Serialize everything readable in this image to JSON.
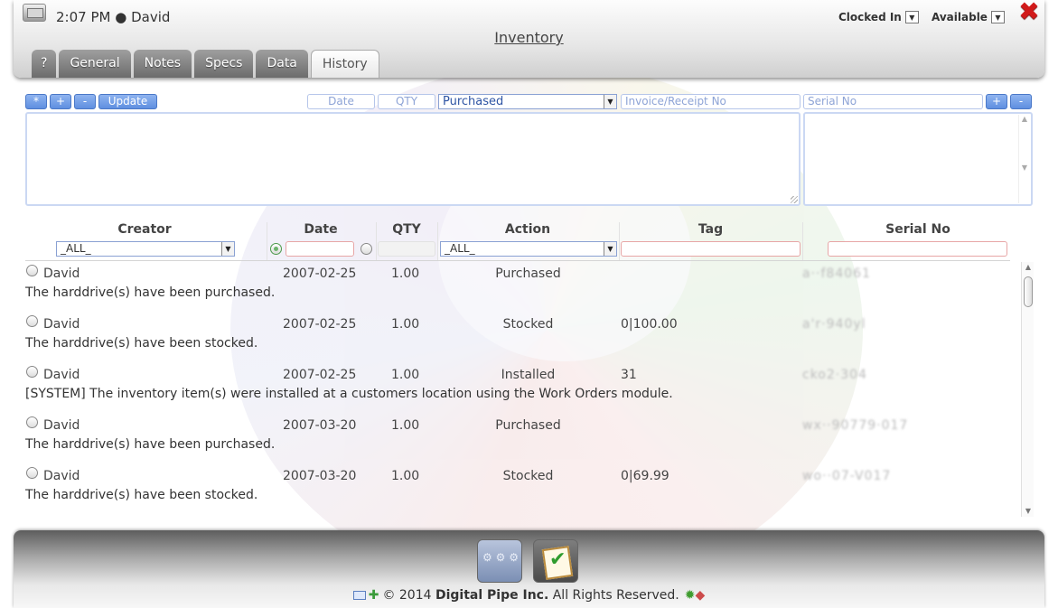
{
  "header": {
    "time": "2:07 PM",
    "user": "David",
    "clock_status": "Clocked In",
    "availability": "Available",
    "title": "Inventory",
    "tabs": [
      {
        "label": "?"
      },
      {
        "label": "General"
      },
      {
        "label": "Notes"
      },
      {
        "label": "Specs"
      },
      {
        "label": "Data"
      },
      {
        "label": "History"
      }
    ],
    "active_tab": "History"
  },
  "entry": {
    "buttons": {
      "star": "*",
      "add": "+",
      "remove": "-",
      "update": "Update"
    },
    "date_placeholder": "Date",
    "qty_placeholder": "QTY",
    "action_value": "Purchased",
    "invoice_placeholder": "Invoice/Receipt No",
    "serial_placeholder": "Serial No",
    "serial_add": "+",
    "serial_remove": "-"
  },
  "table": {
    "columns": {
      "creator": "Creator",
      "date": "Date",
      "qty": "QTY",
      "action": "Action",
      "tag": "Tag",
      "serial": "Serial No"
    },
    "filters": {
      "creator": "_ALL_",
      "action": "_ALL_"
    },
    "rows": [
      {
        "creator": "David",
        "date": "2007-02-25",
        "qty": "1.00",
        "action": "Purchased",
        "tag": "",
        "serial": "a··f84061",
        "note": "The harddrive(s) have been purchased."
      },
      {
        "creator": "David",
        "date": "2007-02-25",
        "qty": "1.00",
        "action": "Stocked",
        "tag": "0|100.00",
        "serial": "a'r·940yl",
        "note": "The harddrive(s) have been stocked."
      },
      {
        "creator": "David",
        "date": "2007-02-25",
        "qty": "1.00",
        "action": "Installed",
        "tag": "31",
        "serial": "cko2·304",
        "note": "[SYSTEM] The inventory item(s) were installed at a customers location using the Work Orders module."
      },
      {
        "creator": "David",
        "date": "2007-03-20",
        "qty": "1.00",
        "action": "Purchased",
        "tag": "",
        "serial": "wx··90779·017",
        "note": "The harddrive(s) have been purchased."
      },
      {
        "creator": "David",
        "date": "2007-03-20",
        "qty": "1.00",
        "action": "Stocked",
        "tag": "0|69.99",
        "serial": "wo··07-V017",
        "note": "The harddrive(s) have been stocked."
      }
    ]
  },
  "footer": {
    "copyright_prefix": "© 2014",
    "company": "Digital Pipe Inc.",
    "rights": "All Rights Reserved."
  },
  "colors": {
    "accent": "#5f8fe0",
    "close": "#d11a1a",
    "tab_active": "#ffffff"
  }
}
